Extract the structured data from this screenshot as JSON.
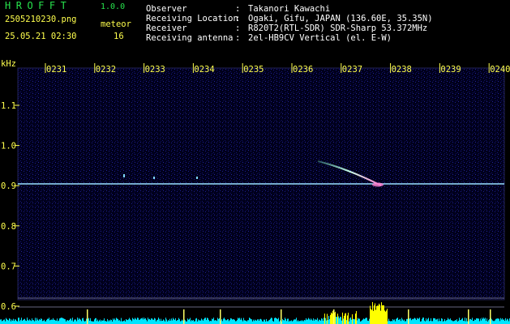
{
  "header": {
    "app_title": "HROFFT",
    "app_version": "1.0.0",
    "file_name": "2505210230.png",
    "meteor_label": "meteor",
    "datetime": "25.05.21 02:30",
    "meteor_count": "16"
  },
  "info": [
    {
      "key": "Observer",
      "value": "Takanori Kawachi"
    },
    {
      "key": "Receiving Location",
      "value": "Ogaki, Gifu, JAPAN (136.60E, 35.35N)"
    },
    {
      "key": "Receiver",
      "value": "R820T2(RTL-SDR) SDR-Sharp 53.372MHz"
    },
    {
      "key": "Receiving antenna",
      "value": "2el-HB9CV Vertical (el. E-W)"
    }
  ],
  "separator": ":",
  "spectrogram": {
    "freq_unit": "kHz",
    "time_ticks": [
      "0231",
      "0232",
      "0233",
      "0234",
      "0235",
      "0236",
      "0237",
      "0238",
      "0239",
      "0240"
    ],
    "freq_ticks": [
      "1.1",
      "1.0",
      "0.9",
      "0.8",
      "0.7",
      "0.6"
    ],
    "colors": {
      "text": "#ffff4d",
      "title": "#27e34d",
      "background": "#000000",
      "noise": "#1a1a80",
      "carrier": "#7fd8ff",
      "trail": "#bfffe0",
      "level": "#00e5ff",
      "peak": "#ffff00"
    }
  }
}
